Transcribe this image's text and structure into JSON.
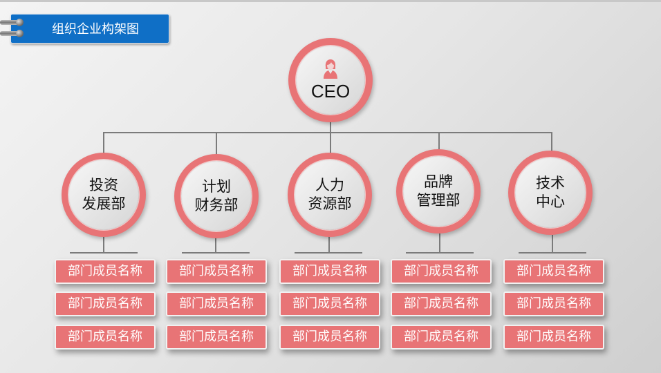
{
  "header": {
    "title": "组织企业构架图",
    "accent_color": "#0f6fc6"
  },
  "ceo": {
    "label": "CEO",
    "icon": "person-icon",
    "ring_color": "#e87476"
  },
  "departments": [
    {
      "line1": "投资",
      "line2": "发展部",
      "members": [
        "部门成员名称",
        "部门成员名称",
        "部门成员名称"
      ]
    },
    {
      "line1": "计划",
      "line2": "财务部",
      "members": [
        "部门成员名称",
        "部门成员名称",
        "部门成员名称"
      ]
    },
    {
      "line1": "人力",
      "line2": "资源部",
      "members": [
        "部门成员名称",
        "部门成员名称",
        "部门成员名称"
      ]
    },
    {
      "line1": "品牌",
      "line2": "管理部",
      "members": [
        "部门成员名称",
        "部门成员名称",
        "部门成员名称"
      ]
    },
    {
      "line1": "技术",
      "line2": "中心",
      "members": [
        "部门成员名称",
        "部门成员名称",
        "部门成员名称"
      ]
    }
  ]
}
